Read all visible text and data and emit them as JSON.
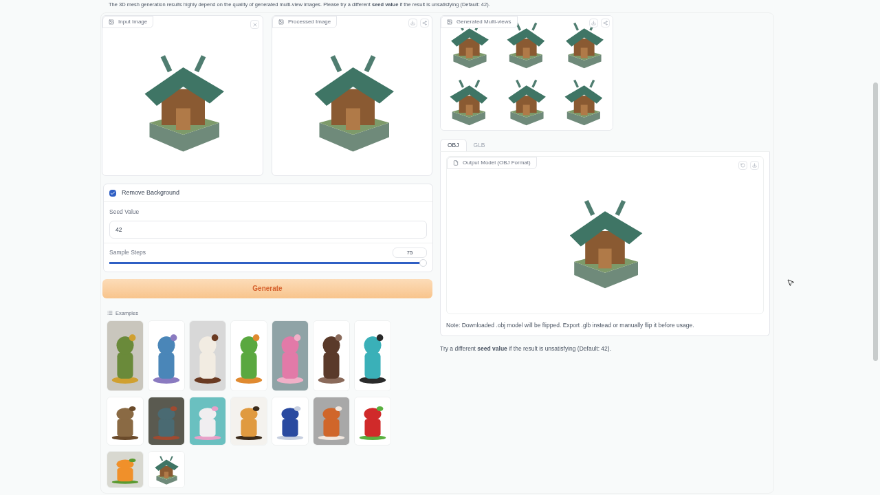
{
  "intro_note": "The 3D mesh generation results highly depend on the quality of generated multi-view images. Please try a different **seed value** if the result is unsatisfying (Default: 42).",
  "input_image": {
    "label": "Input Image"
  },
  "processed_image": {
    "label": "Processed Image"
  },
  "multi_views": {
    "label": "Generated Multi-views"
  },
  "remove_background": {
    "label": "Remove Background",
    "checked": true
  },
  "seed": {
    "label": "Seed Value",
    "value": "42"
  },
  "sample_steps": {
    "label": "Sample Steps",
    "value": "75",
    "level": 1.0
  },
  "generate_button": "Generate",
  "examples": {
    "label": "Examples"
  },
  "output_tabs": [
    {
      "label": "OBJ",
      "selected": true
    },
    {
      "label": "GLB",
      "selected": false
    }
  ],
  "output_model": {
    "label": "Output Model (OBJ Format)"
  },
  "flip_note": "Note: Downloaded .obj model will be flipped. Export .glb instead or manually flip it before usage.",
  "seed_hint": "Try a different **seed value** if the result is unsatisfying (Default: 42)."
}
